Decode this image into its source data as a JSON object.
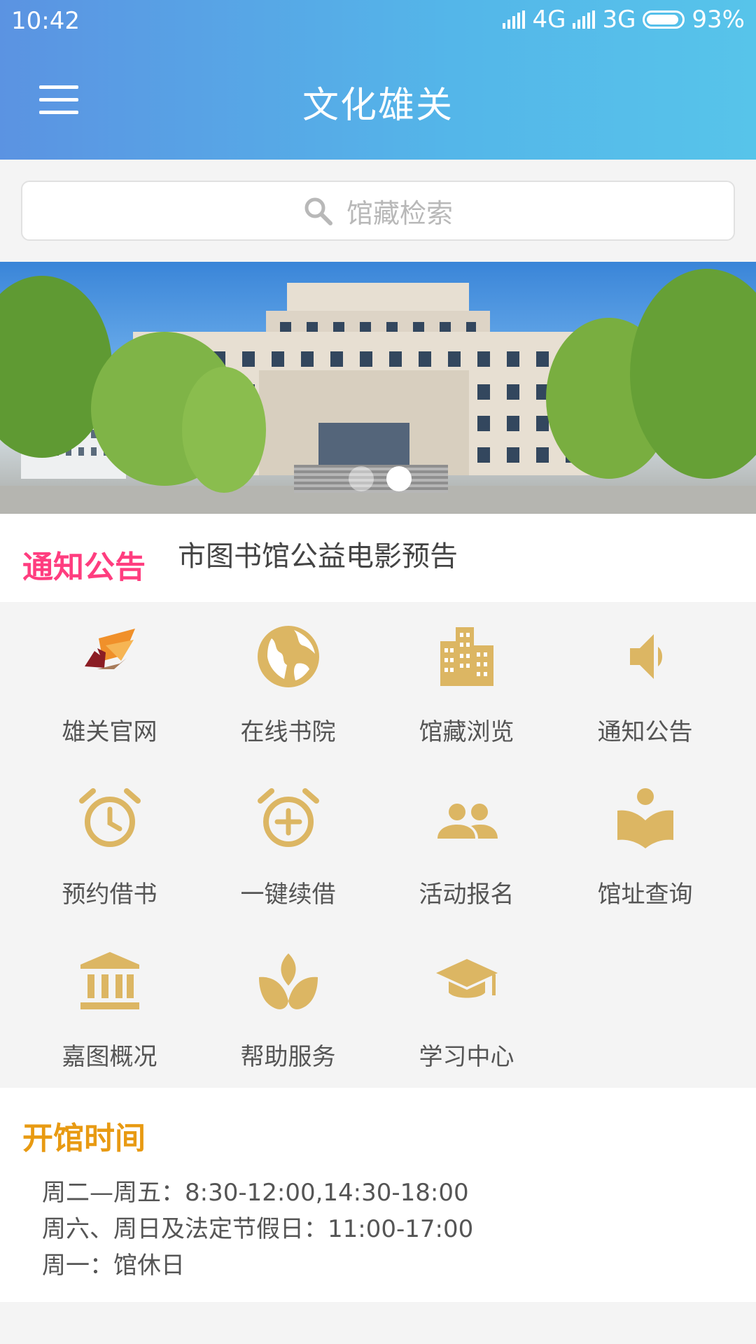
{
  "status_bar": {
    "time": "10:42",
    "network1": "4G",
    "network2": "3G",
    "battery": "93%"
  },
  "header": {
    "title": "文化雄关",
    "menu_icon": "hamburger-menu-icon"
  },
  "search": {
    "placeholder": "馆藏检索",
    "icon": "search-icon"
  },
  "banner": {
    "slide_count": 2,
    "active_slide": 2
  },
  "notice": {
    "label": "通知公告",
    "text": "市图书馆公益电影预告"
  },
  "accent_colors": {
    "icon_gold": "#dcb663",
    "notice_pink": "#ff3d7f",
    "hours_orange": "#e89a12",
    "header_start": "#5b93e2",
    "header_end": "#57c4ea"
  },
  "grid": {
    "items": [
      {
        "label": "雄关官网",
        "icon": "logo-leaf-icon"
      },
      {
        "label": "在线书院",
        "icon": "globe-icon"
      },
      {
        "label": "馆藏浏览",
        "icon": "building-icon"
      },
      {
        "label": "通知公告",
        "icon": "speaker-icon"
      },
      {
        "label": "预约借书",
        "icon": "alarm-clock-icon"
      },
      {
        "label": "一键续借",
        "icon": "alarm-add-icon"
      },
      {
        "label": "活动报名",
        "icon": "people-icon"
      },
      {
        "label": "馆址查询",
        "icon": "reading-person-icon"
      },
      {
        "label": "嘉图概况",
        "icon": "bank-icon"
      },
      {
        "label": "帮助服务",
        "icon": "lotus-icon"
      },
      {
        "label": "学习中心",
        "icon": "graduation-cap-icon"
      }
    ]
  },
  "hours": {
    "title": "开馆时间",
    "lines": [
      "周二—周五：8:30-12:00,14:30-18:00",
      "周六、周日及法定节假日：11:00-17:00",
      "周一：馆休日"
    ]
  }
}
